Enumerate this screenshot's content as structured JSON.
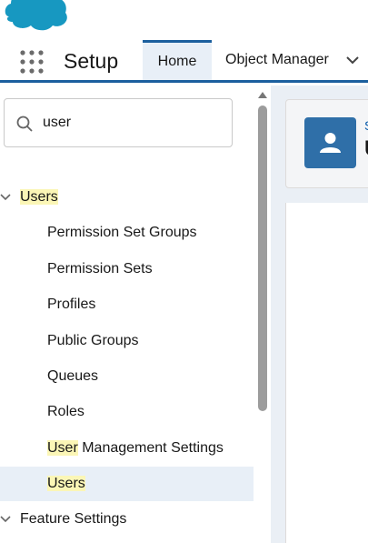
{
  "nav": {
    "app_name": "Setup",
    "tabs": [
      {
        "label": "Home"
      },
      {
        "label": "Object Manager"
      }
    ]
  },
  "sidebar": {
    "search_value": "user",
    "tree": [
      {
        "label": "Users",
        "highlight": "Users",
        "rest": "",
        "level": 0,
        "expanded": true
      },
      {
        "label": "Permission Set Groups",
        "level": 1
      },
      {
        "label": "Permission Sets",
        "level": 1
      },
      {
        "label": "Profiles",
        "level": 1
      },
      {
        "label": "Public Groups",
        "level": 1
      },
      {
        "label": "Queues",
        "level": 1
      },
      {
        "label": "Roles",
        "level": 1
      },
      {
        "label": "User Management Settings",
        "highlight": "User",
        "rest": " Management Settings",
        "level": 1
      },
      {
        "label": "Users",
        "highlight": "Users",
        "rest": "",
        "level": 1,
        "selected": true
      },
      {
        "label": "Feature Settings",
        "level": 0,
        "expanded": true
      }
    ]
  },
  "main": {
    "breadcrumb": "S",
    "title": "U"
  },
  "colors": {
    "brand_blue": "#1b5f9e",
    "selected_bg": "#e8eff7",
    "highlight": "#fbf6b6",
    "logo": "#1798c1"
  },
  "icons": [
    "salesforce-cloud-logo",
    "app-launcher-icon",
    "chevron-down-icon",
    "search-icon",
    "caret-down-icon",
    "user-icon",
    "scroll-up-arrow-icon"
  ]
}
